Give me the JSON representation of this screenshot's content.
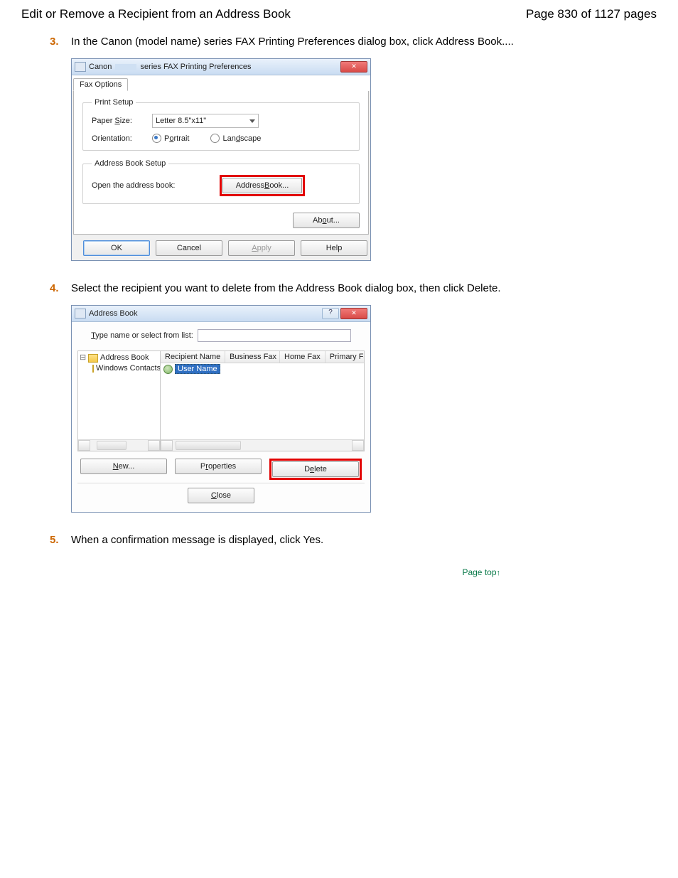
{
  "header": {
    "title": "Edit or Remove a Recipient from an Address Book",
    "page_position": "Page 830 of 1127 pages"
  },
  "steps": {
    "s3": {
      "num": "3.",
      "text": "In the Canon (model name) series FAX Printing Preferences dialog box, click Address Book...."
    },
    "s4": {
      "num": "4.",
      "text": "Select the recipient you want to delete from the Address Book dialog box, then click Delete."
    },
    "s5": {
      "num": "5.",
      "text": "When a confirmation message is displayed, click Yes."
    }
  },
  "pref_dialog": {
    "title_prefix": "Canon",
    "title_suffix": "series FAX Printing Preferences",
    "tab": "Fax Options",
    "print_setup_legend": "Print Setup",
    "paper_size_label": "Paper Size:",
    "paper_size_value": "Letter 8.5\"x11\"",
    "orientation_label": "Orientation:",
    "orientation_portrait": "Portrait",
    "orientation_landscape": "Landscape",
    "ab_setup_legend": "Address Book Setup",
    "open_ab_label": "Open the address book:",
    "address_book_btn": "Address Book...",
    "about_btn": "About...",
    "ok": "OK",
    "cancel": "Cancel",
    "apply": "Apply",
    "help": "Help"
  },
  "ab_dialog": {
    "title": "Address Book",
    "type_label": "Type name or select from list:",
    "tree_root": "Address Book",
    "tree_child": "Windows Contacts",
    "col_recipient": "Recipient Name",
    "col_business": "Business Fax",
    "col_home": "Home Fax",
    "col_primary": "Primary Fax",
    "selected_item": "User Name",
    "new_btn": "New...",
    "properties_btn": "Properties",
    "delete_btn": "Delete",
    "close_btn": "Close"
  },
  "page_top": "Page top"
}
